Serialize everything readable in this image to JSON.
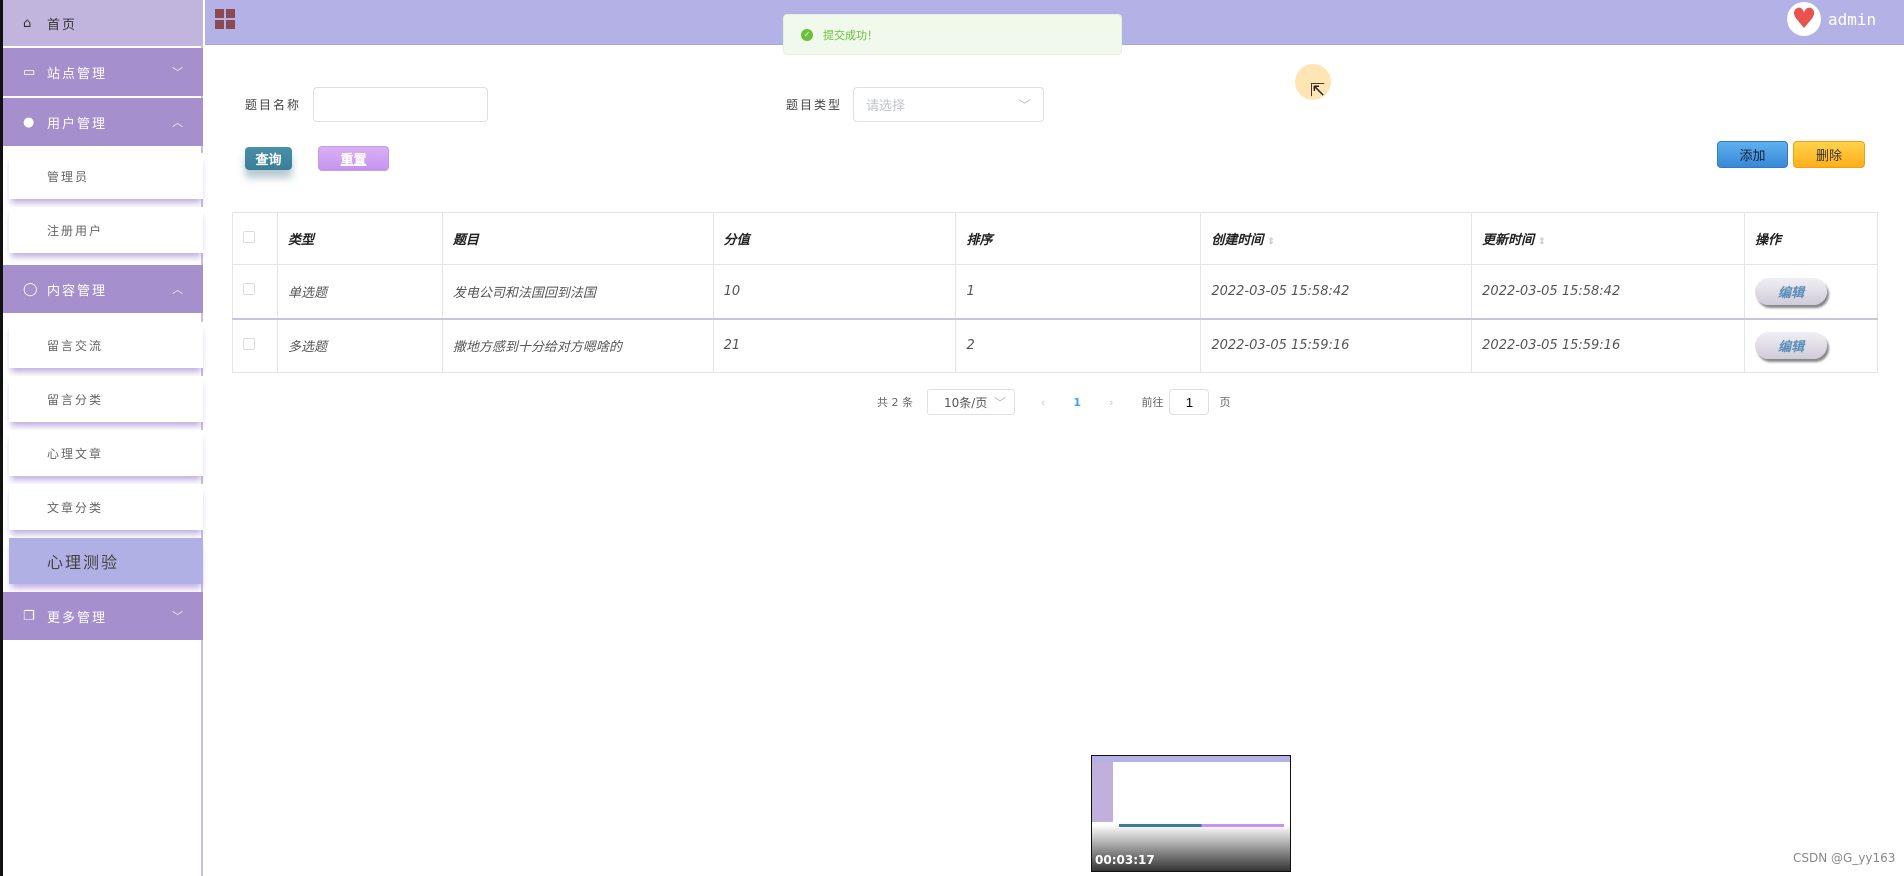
{
  "sidebar": {
    "home": "首页",
    "groups": [
      {
        "label": "站点管理",
        "icon": "monitor-icon"
      },
      {
        "label": "用户管理",
        "icon": "user-icon",
        "items": [
          "管理员",
          "注册用户"
        ]
      },
      {
        "label": "内容管理",
        "icon": "chat-icon",
        "items": [
          "留言交流",
          "留言分类",
          "心理文章",
          "文章分类",
          "心理测验"
        ]
      },
      {
        "label": "更多管理",
        "icon": "copy-icon"
      }
    ],
    "active": "心理测验"
  },
  "header": {
    "user": "admin"
  },
  "toast": {
    "message": "提交成功！"
  },
  "search": {
    "name_label": "题目名称",
    "name_value": "",
    "type_label": "题目类型",
    "type_placeholder": "请选择",
    "query": "查询",
    "reset": "重置"
  },
  "actions": {
    "add": "添加",
    "delete": "删除"
  },
  "table": {
    "headers": [
      "类型",
      "题目",
      "分值",
      "排序",
      "创建时间",
      "更新时间",
      "操作"
    ],
    "rows": [
      [
        "单选题",
        "发电公司和法国回到法国",
        "10",
        "1",
        "2022-03-05 15:58:42",
        "2022-03-05 15:58:42"
      ],
      [
        "多选题",
        "撒地方感到十分给对方嗯啥的",
        "21",
        "2",
        "2022-03-05 15:59:16",
        "2022-03-05 15:59:16"
      ]
    ],
    "edit": "编辑"
  },
  "pager": {
    "total": "共 2 条",
    "size": "10条/页",
    "page": "1",
    "goto": "前往",
    "goto_value": "1",
    "page_suffix": "页"
  },
  "video": {
    "time": "00:03:17"
  },
  "watermark": "CSDN @G_yy163"
}
